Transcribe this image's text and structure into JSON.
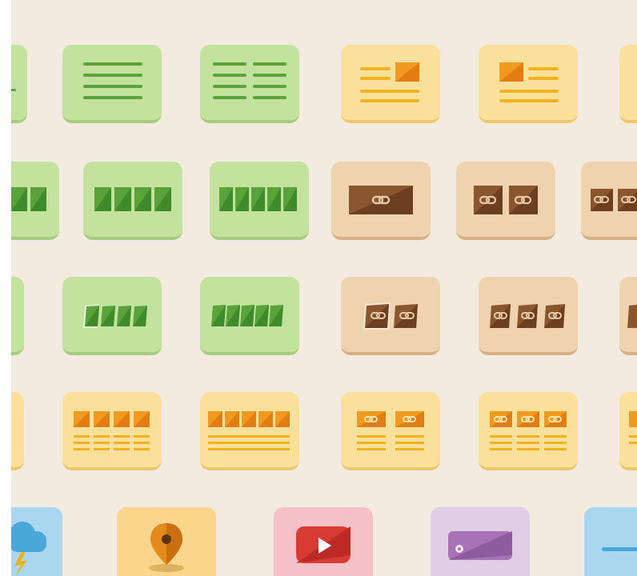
{
  "palette": {
    "background": "#f3ebdf",
    "green_tile": "#c3e29e",
    "green_line": "#5aa33b",
    "yellow_tile": "#fbe09b",
    "orange": "#f29a1f",
    "tan_tile": "#efd3ae",
    "brown": "#7a4a28",
    "pink_tile": "#f6c2c8",
    "youtube_red": "#d83a34",
    "lavender_tile": "#e0cde6",
    "purple": "#a772b6",
    "sky_tile": "#a9d7ef",
    "blue": "#4aa7d9"
  },
  "rows": [
    {
      "name": "text-layouts",
      "icons": [
        "partial-lines-icon",
        "text-lines-icon",
        "two-column-text-icon",
        "text-with-image-right-icon",
        "text-with-image-left-icon",
        "partial-card-icon"
      ]
    },
    {
      "name": "image-galleries",
      "icons": [
        "partial-gallery-icon",
        "four-image-gallery-icon",
        "five-image-gallery-icon",
        "single-link-image-icon",
        "two-link-images-icon",
        "partial-link-images-icon"
      ]
    },
    {
      "name": "tilted-galleries",
      "icons": [
        "partial-tilted-icon",
        "four-tilted-images-icon",
        "five-tilted-images-icon",
        "two-tilted-link-images-icon",
        "three-tilted-link-images-icon",
        "partial-tilted-link-icon"
      ]
    },
    {
      "name": "grid-layouts",
      "icons": [
        "partial-grid-icon",
        "four-column-grid-icon",
        "five-column-grid-icon",
        "two-link-columns-icon",
        "three-link-columns-icon",
        "partial-link-grid-icon"
      ]
    },
    {
      "name": "media-widgets",
      "icons": [
        "cloud-icon",
        "map-pin-icon",
        "youtube-play-icon",
        "media-player-icon",
        "partial-divider-icon"
      ]
    }
  ]
}
